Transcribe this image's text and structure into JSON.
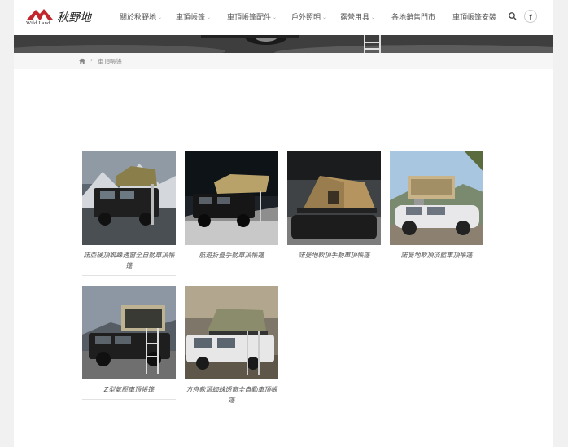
{
  "brand": {
    "name_en": "Wild Land",
    "name_zh": "秋野地",
    "accent_color": "#c1272d"
  },
  "nav": {
    "items": [
      {
        "label": "關於秋野地",
        "caret": true
      },
      {
        "label": "車頂帳篷",
        "caret": true
      },
      {
        "label": "車頂帳篷配件",
        "caret": true
      },
      {
        "label": "戶外照明",
        "caret": true
      },
      {
        "label": "露營用具",
        "caret": true
      },
      {
        "label": "各地銷售門市",
        "caret": false
      },
      {
        "label": "車頂帳篷安裝",
        "caret": false
      }
    ],
    "search_icon": "search-icon",
    "social_icon": "facebook-icon",
    "social_glyph": "f"
  },
  "breadcrumb": {
    "home_icon": "home-icon",
    "separator": "›",
    "current": "車頂帳篷"
  },
  "products": [
    {
      "caption": "諾亞硬頂蜘蛛透窗全自動車頂帳篷"
    },
    {
      "caption": "航遊折疊手動車頂帳篷"
    },
    {
      "caption": "諾曼地軟頂手動車頂帳篷"
    },
    {
      "caption": "諾曼地軟頂淡藍車頂帳篷"
    },
    {
      "caption": "Z型氣壓車頂帳篷"
    },
    {
      "caption": "方舟軟頂蜘蛛透窗全自動車頂帳篷"
    }
  ]
}
